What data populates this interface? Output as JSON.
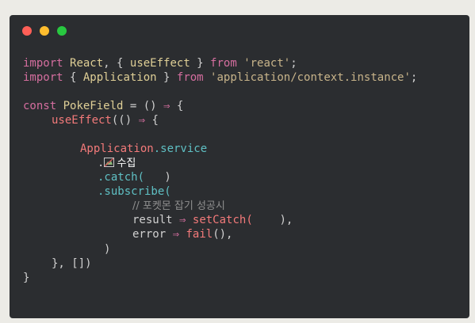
{
  "colors": {
    "window_bg": "#2b2d30",
    "page_bg": "#ecebe6",
    "close": "#ff5f57",
    "minimize": "#ffbd2e",
    "maximize": "#28c840",
    "keyword": "#d56e9f",
    "plain": "#d0d0d0",
    "string": "#c8b48a",
    "identifier": "#dfcf96",
    "type": "#5fc0c4",
    "function": "#f37a7a",
    "comment": "#8f8f8f",
    "korean": "#ffffff"
  },
  "icons": [
    "broken-image-icon"
  ],
  "code": {
    "line1": {
      "t1": "import",
      "t2": "React",
      "t3": ", { ",
      "t4": "useEffect",
      "t5": " } ",
      "t6": "from",
      "t7": "'react'",
      "t8": ";"
    },
    "line2": {
      "t1": "import",
      "t2": " { ",
      "t3": "Application",
      "t4": " } ",
      "t5": "from",
      "t6": "'application/context.instance'",
      "t7": ";"
    },
    "line3": {
      "t1": "const",
      "t2": "PokeField",
      "t3": " = () ",
      "t4": "⇒",
      "t5": " {"
    },
    "line4": {
      "t1": "useEffect",
      "t2": "(() ",
      "t3": "⇒",
      "t4": " {"
    },
    "line5": {
      "t1": "Application",
      "t2": ".service"
    },
    "line6": {
      "t1": ".",
      "t2": "수집"
    },
    "line7": {
      "t1": ".catch(",
      "t2": ")"
    },
    "line8": {
      "t1": ".subscribe("
    },
    "line9": {
      "t1": "// 포켓몬 잡기 성공시"
    },
    "line10": {
      "t1": "result",
      "t2": "⇒",
      "t3": "setCatch(",
      "t4": "),"
    },
    "line11": {
      "t1": "error",
      "t2": "⇒",
      "t3": "fail",
      "t4": "(),"
    },
    "line12": {
      "t1": ")"
    },
    "line13": {
      "t1": "}, [])"
    },
    "line14": {
      "t1": "}"
    }
  }
}
